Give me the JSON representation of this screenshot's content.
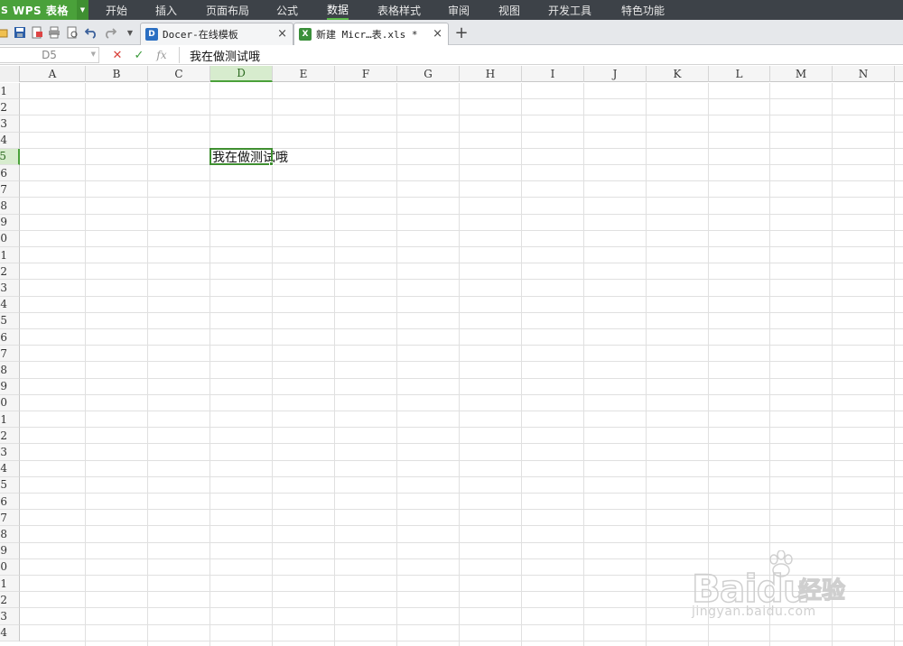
{
  "app": {
    "name": "WPS 表格",
    "logo": "S"
  },
  "menu": [
    "开始",
    "插入",
    "页面布局",
    "公式",
    "数据",
    "表格样式",
    "审阅",
    "视图",
    "开发工具",
    "特色功能"
  ],
  "menu_active": "数据",
  "tabs": [
    {
      "label": "Docer-在线模板",
      "close": "×",
      "icon": "D",
      "icon_color": "#2b6fc2"
    },
    {
      "label": "新建 Micr…表.xls *",
      "close": "×",
      "icon": "X",
      "icon_color": "#3a8f3a"
    }
  ],
  "newtab": "+",
  "formula": {
    "namebox": "D5",
    "cancel": "✕",
    "confirm": "✓",
    "fx": "fx",
    "value": "我在做测试哦"
  },
  "columns": [
    "A",
    "B",
    "C",
    "D",
    "E",
    "F",
    "G",
    "H",
    "I",
    "J",
    "K",
    "L",
    "M",
    "N"
  ],
  "rows": [
    "1",
    "2",
    "3",
    "4",
    "5",
    "6",
    "7",
    "8",
    "9",
    "10",
    "11",
    "12",
    "13",
    "14",
    "15",
    "16",
    "17",
    "18",
    "19",
    "20",
    "21",
    "22",
    "23",
    "24",
    "25",
    "26",
    "27",
    "28",
    "29",
    "30",
    "31",
    "32",
    "33",
    "34"
  ],
  "active_cell": {
    "ref": "D5",
    "col": "D",
    "row": "5",
    "value": "我在做测试哦"
  },
  "colors": {
    "accent": "#4aa13a",
    "menubar": "#3d4248"
  }
}
